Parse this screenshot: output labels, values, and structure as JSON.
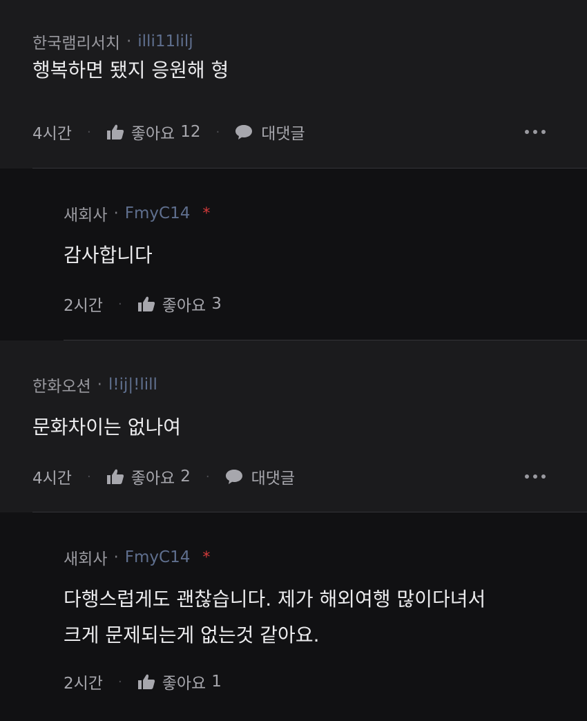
{
  "comments": [
    {
      "nickname": "한국램리서치",
      "user_id": "illi11lilj",
      "body": "행복하면 됐지 응원해 형",
      "time": "4시간",
      "like_label": "좋아요",
      "like_count": "12",
      "reply_label": "대댓글"
    },
    {
      "nickname": "새회사",
      "user_id": "FmyC14",
      "author_mark": "*",
      "body": "감사합니다",
      "time": "2시간",
      "like_label": "좋아요",
      "like_count": "3"
    },
    {
      "nickname": "한화오션",
      "user_id": "l!ij|!lill",
      "body": "문화차이는 없나여",
      "time": "4시간",
      "like_label": "좋아요",
      "like_count": "2",
      "reply_label": "대댓글"
    },
    {
      "nickname": "새회사",
      "user_id": "FmyC14",
      "author_mark": "*",
      "body_line1": "다행스럽게도 괜찮습니다. 제가 해외여행 많이다녀서",
      "body_line2": "크게 문제되는게 없는것 같아요.",
      "time": "2시간",
      "like_label": "좋아요",
      "like_count": "1"
    }
  ],
  "separator": "·",
  "colors": {
    "background": "#1b1b1d",
    "reply_background": "#111113",
    "user_id": "#5f6f8e",
    "author_mark": "#d33a3a"
  }
}
